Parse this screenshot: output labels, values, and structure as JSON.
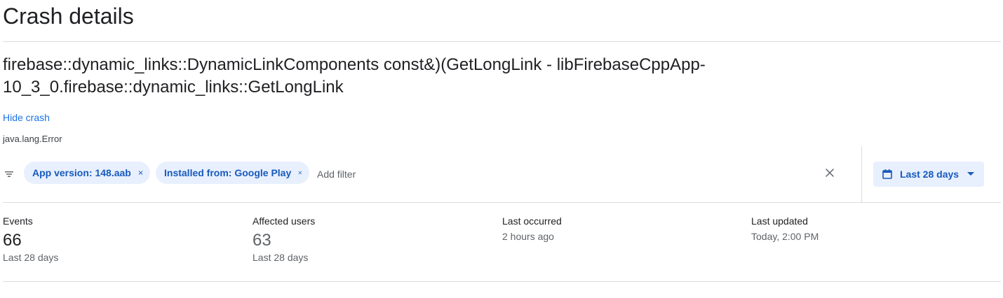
{
  "page": {
    "title": "Crash details"
  },
  "crash": {
    "title_line1": "firebase::dynamic_links::DynamicLinkComponents const&)(GetLongLink - libFirebaseCppApp-",
    "title_line2": "10_3_0.firebase::dynamic_links::GetLongLink",
    "hide_label": "Hide crash",
    "exception_type": "java.lang.Error"
  },
  "filters": {
    "chips": [
      {
        "label": "App version: 148.aab"
      },
      {
        "label": "Installed from: Google Play"
      }
    ],
    "add_placeholder": "Add filter",
    "date_range_label": "Last 28 days"
  },
  "stats": [
    {
      "label": "Events",
      "value": "66",
      "sub": "Last 28 days"
    },
    {
      "label": "Affected users",
      "value": "63",
      "sub": "Last 28 days"
    },
    {
      "label": "Last occurred",
      "sub": "2 hours ago"
    },
    {
      "label": "Last updated",
      "sub": "Today, 2:00 PM"
    }
  ],
  "colors": {
    "accent": "#1a73e8",
    "chip_bg": "#e8f0fe",
    "chip_text": "#185abc",
    "divider": "#dadce0"
  },
  "icons": [
    "filter-icon",
    "close-icon",
    "calendar-icon",
    "dropdown-arrow-icon"
  ]
}
